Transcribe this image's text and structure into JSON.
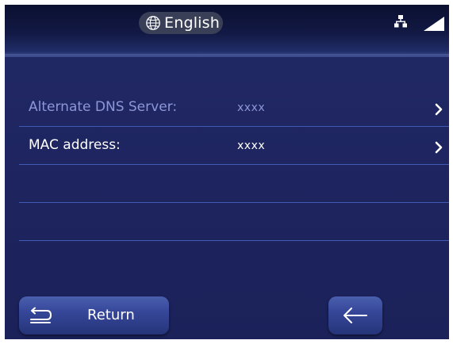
{
  "status_bar": {
    "language": "English",
    "language_icon": "globe-icon",
    "network_icon": "network-icon",
    "signal_icon": "signal-icon"
  },
  "settings": {
    "rows": [
      {
        "label": "Alternate DNS Server:",
        "value": "xxxx",
        "state": "dimmed"
      },
      {
        "label": "MAC address:",
        "value": "xxxx",
        "state": "normal"
      }
    ]
  },
  "footer": {
    "return_label": "Return",
    "return_icon": "return-icon",
    "back_icon": "arrow-left-icon"
  },
  "colors": {
    "background": "#1f2660",
    "divider": "#3f5bb4",
    "dimmed_text": "#8d97d8",
    "button": "#36479a"
  }
}
